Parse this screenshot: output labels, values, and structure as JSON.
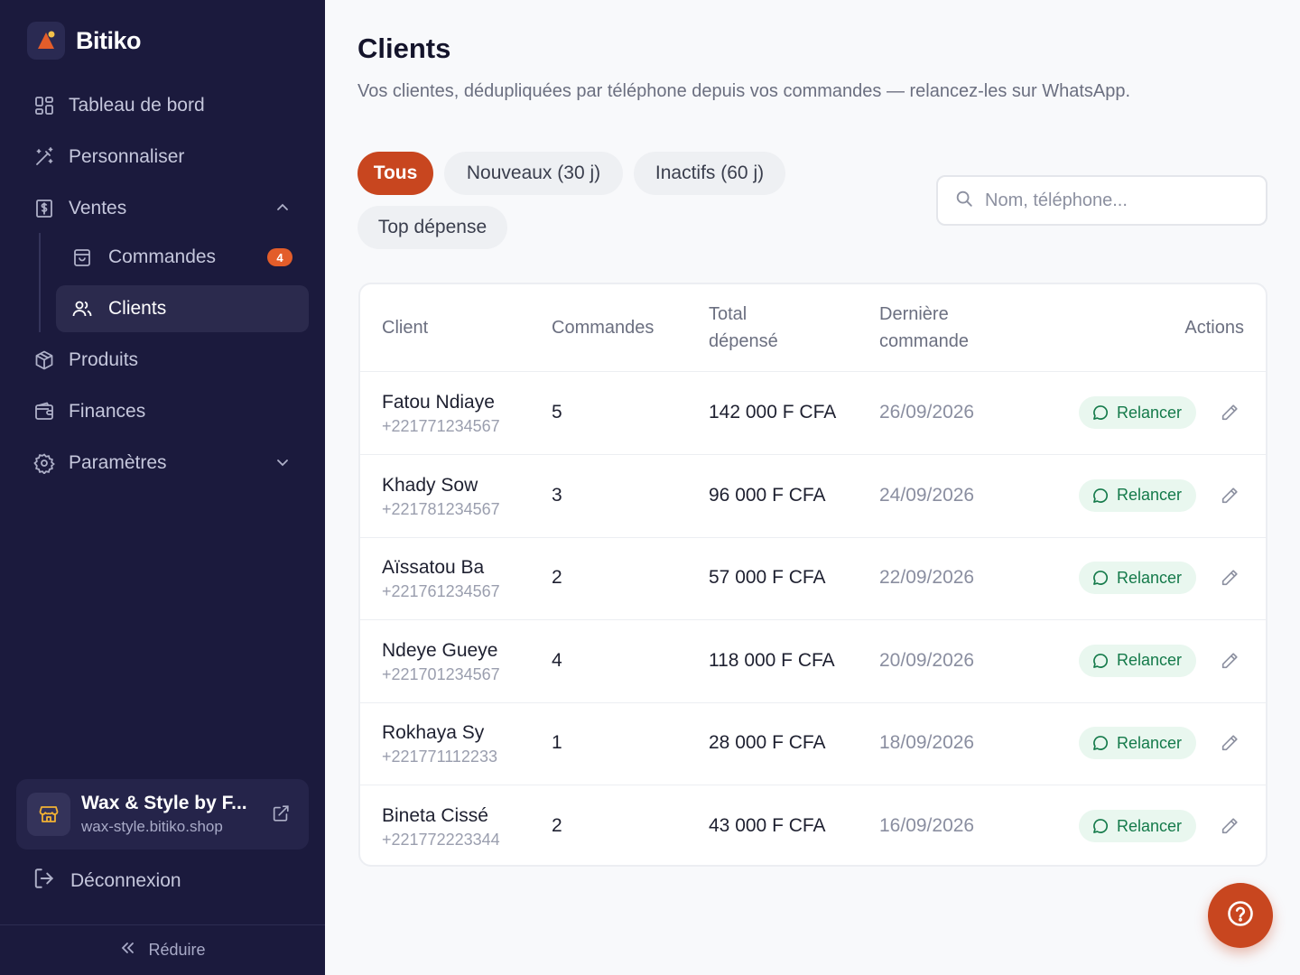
{
  "brand": {
    "name": "Bitiko"
  },
  "sidebar": {
    "items": [
      {
        "label": "Tableau de bord",
        "icon": "dashboard-icon"
      },
      {
        "label": "Personnaliser",
        "icon": "magic-wand-icon"
      },
      {
        "label": "Ventes",
        "icon": "receipt-icon"
      },
      {
        "label": "Produits",
        "icon": "box-icon"
      },
      {
        "label": "Finances",
        "icon": "wallet-icon"
      },
      {
        "label": "Paramètres",
        "icon": "gear-icon"
      }
    ],
    "subitems": [
      {
        "label": "Commandes",
        "icon": "shopping-bag-icon",
        "badge": "4"
      },
      {
        "label": "Clients",
        "icon": "users-icon"
      }
    ],
    "shop": {
      "name": "Wax & Style by F...",
      "url": "wax-style.bitiko.shop"
    },
    "logout": "Déconnexion",
    "collapse": "Réduire"
  },
  "page": {
    "title": "Clients",
    "subtitle": "Vos clientes, dédupliquées par téléphone depuis vos commandes — relancez-les sur WhatsApp."
  },
  "filters": [
    {
      "label": "Tous",
      "active": true
    },
    {
      "label": "Nouveaux (30 j)",
      "active": false
    },
    {
      "label": "Inactifs (60 j)",
      "active": false
    },
    {
      "label": "Top dépense",
      "active": false
    }
  ],
  "search": {
    "placeholder": "Nom, téléphone..."
  },
  "table": {
    "headers": {
      "client": "Client",
      "orders": "Commandes",
      "total": "Total dépensé",
      "last_order": "Dernière commande",
      "actions": "Actions"
    },
    "action_label": "Relancer",
    "rows": [
      {
        "name": "Fatou Ndiaye",
        "phone": "+221771234567",
        "orders": "5",
        "total": "142 000 F CFA",
        "last_order": "26/09/2026"
      },
      {
        "name": "Khady Sow",
        "phone": "+221781234567",
        "orders": "3",
        "total": "96 000 F CFA",
        "last_order": "24/09/2026"
      },
      {
        "name": "Aïssatou Ba",
        "phone": "+221761234567",
        "orders": "2",
        "total": "57 000 F CFA",
        "last_order": "22/09/2026"
      },
      {
        "name": "Ndeye Gueye",
        "phone": "+221701234567",
        "orders": "4",
        "total": "118 000 F CFA",
        "last_order": "20/09/2026"
      },
      {
        "name": "Rokhaya Sy",
        "phone": "+221771112233",
        "orders": "1",
        "total": "28 000 F CFA",
        "last_order": "18/09/2026"
      },
      {
        "name": "Bineta Cissé",
        "phone": "+221772223344",
        "orders": "2",
        "total": "43 000 F CFA",
        "last_order": "16/09/2026"
      }
    ]
  },
  "colors": {
    "sidebar": "#1b1a3d",
    "accent": "#c8461f",
    "success": "#147a4a"
  }
}
